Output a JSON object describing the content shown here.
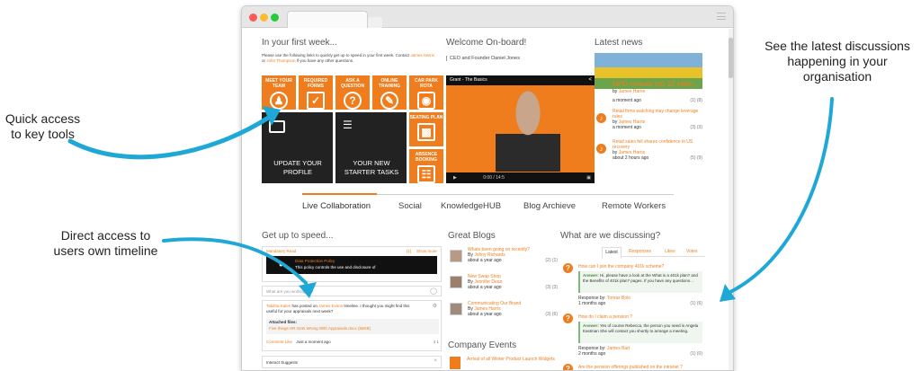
{
  "callouts": {
    "quick_access": "Quick access\nto key tools",
    "timeline": "Direct access to\nusers own timeline",
    "discussions": "See the latest discussions\nhappening in your\norganisation"
  },
  "colors": {
    "accent": "#f07d1d",
    "arrow": "#1fa8d6",
    "dark_tile": "#222222"
  },
  "first_week": {
    "title": "In your first week...",
    "intro": "Please use the following links to quickly get up to speed in your first week. Contact",
    "contact_1": "James Harris",
    "or": "or",
    "contact_2": "John Thompson",
    "intro_end": "if you have any other questions.",
    "tiles": [
      {
        "label": "MEET YOUR TEAM",
        "icon": "team-icon"
      },
      {
        "label": "REQUIRED FORMS",
        "icon": "forms-icon"
      },
      {
        "label": "ASK A QUESTION",
        "icon": "question-icon"
      },
      {
        "label": "ONLINE TRAINING",
        "icon": "training-icon"
      },
      {
        "label": "CAR PARK ROTA",
        "icon": "car-icon"
      },
      {
        "label": "SEATING PLAN",
        "icon": "seating-icon"
      },
      {
        "label": "ABSENCE BOOKING",
        "icon": "absence-icon"
      }
    ],
    "dark_tiles": [
      {
        "label": "UPDATE YOUR PROFILE",
        "icon": "profile-card-icon"
      },
      {
        "label": "YOUR NEW STARTER TASKS",
        "icon": "task-list-icon"
      }
    ]
  },
  "welcome": {
    "title": "Welcome On-board!",
    "subtitle": "CEO and Founder Daniel Jones",
    "video_title": "Grant - The Basics",
    "video_time": "0:00 / 14:5"
  },
  "news": {
    "title": "Latest news",
    "headline": "NPD reveals top 10 sellin...",
    "headline_by": "James Harris",
    "headline_time": "a moment ago",
    "headline_stats": "(1) (8)",
    "items": [
      {
        "title": "Retail firms watching may change leverage rules",
        "by": "James Harris",
        "time": "a moment ago",
        "stats": "(3) (3)"
      },
      {
        "title": "Retail sales fell shares confidence in US recovery",
        "by": "James Harris",
        "time": "about 2 hours ago",
        "stats": "(5) (9)"
      }
    ]
  },
  "nav": {
    "items": [
      "Live Collaboration",
      "Social",
      "KnowledgeHUB",
      "Blog Archieve",
      "Remote Workers"
    ]
  },
  "speed": {
    "title": "Get up to speed...",
    "mandatory": "Mandatory Read",
    "mandatory_count": "[1]",
    "show_more": "Show more",
    "policy_title": "Data Protection Policy",
    "policy_text": "This policy controls the use and disclosure of",
    "compose_placeholder": "What are you working on?",
    "post_author": "Tabitha Kalen",
    "post_mid": "has posted on",
    "post_target": "James Evans",
    "post_text": "timeline. I thought you might find this useful for your appraisals next week?",
    "attached": "Attached files:",
    "file": "Five things HR Gets Wrong With Appraisals.docx (56KB)",
    "comment": "Comment",
    "like": "Like",
    "post_time": "Just a moment ago",
    "post_stats": "4  1",
    "interact": "Interact Suggests"
  },
  "blogs": {
    "title": "Great Blogs",
    "items": [
      {
        "title": "Whats been going on recently?",
        "by": "Johny Richards",
        "time": "about a year ago",
        "stats": "(2) (1)"
      },
      {
        "title": "New Swap Shop",
        "by": "Jennifer Dean",
        "time": "about a year ago",
        "stats": "(3) (3)"
      },
      {
        "title": "Communicating Our Brand",
        "by": "James Harris",
        "time": "about a year ago",
        "stats": "(3) (6)"
      }
    ],
    "events_title": "Company Events",
    "event": "Arrival of all Winter Product Launch Widgets"
  },
  "discuss": {
    "title": "What are we discussing?",
    "tabs": [
      "Latest",
      "Responses",
      "Likes",
      "Votes"
    ],
    "threads": [
      {
        "q": "How can I join the company 401k scheme?",
        "answer_label": "Answer:",
        "answer": "Hi, please have a look at the What is a 401k plan? and the Benefits of 401k plan? pages. If you have any questions...",
        "resp_label": "Response by:",
        "resp_by": "Tomas Bolo",
        "time": "1 months ago",
        "stats": "(1) (6)"
      },
      {
        "q": "How do I claim a pension ?",
        "answer_label": "Answer:",
        "answer": "Yes of course Rebecca, the person you need is Angela Eastman She will contact you shortly to arrange a meeting.",
        "resp_label": "Response by:",
        "resp_by": "James Bart",
        "time": "2 months ago",
        "stats": "(1) (0)"
      },
      {
        "q": "Are the pension offerings published on the intranet ?"
      }
    ]
  }
}
